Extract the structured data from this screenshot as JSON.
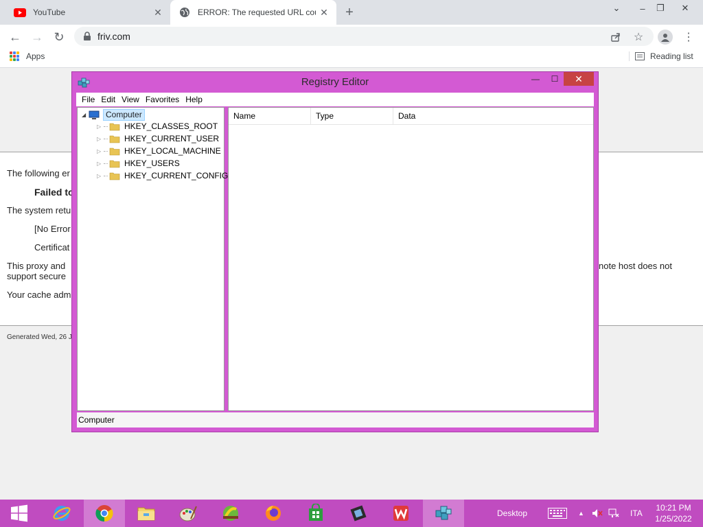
{
  "browser": {
    "tabs": [
      {
        "title": "YouTube",
        "icon": "youtube-icon",
        "active": false
      },
      {
        "title": "ERROR: The requested URL could",
        "icon": "globe-icon",
        "active": true
      }
    ],
    "omnibox": {
      "url": "friv.com"
    },
    "bookmarks": {
      "apps_label": "Apps",
      "reading_list_label": "Reading list"
    }
  },
  "page": {
    "line1": "The following er",
    "line2": "Failed to",
    "line3": "The system retu",
    "line4": "[No Error",
    "line5": "Certificat",
    "line6a": "This proxy and",
    "line6b": "note host does not",
    "line7": "support secure",
    "line8": "Your cache adm",
    "generated": "Generated Wed, 26 J"
  },
  "regedit": {
    "title": "Registry Editor",
    "menu": [
      "File",
      "Edit",
      "View",
      "Favorites",
      "Help"
    ],
    "tree_root": "Computer",
    "hives": [
      "HKEY_CLASSES_ROOT",
      "HKEY_CURRENT_USER",
      "HKEY_LOCAL_MACHINE",
      "HKEY_USERS",
      "HKEY_CURRENT_CONFIG"
    ],
    "columns": [
      "Name",
      "Type",
      "Data"
    ],
    "status": "Computer"
  },
  "taskbar": {
    "apps": [
      "start-button",
      "internet-explorer-icon",
      "chrome-icon",
      "file-explorer-icon",
      "paint-icon",
      "app-icon",
      "firefox-icon",
      "store-icon",
      "movie-maker-icon",
      "wps-office-icon",
      "registry-editor-icon"
    ],
    "active_app": "registry-editor-icon",
    "desktop_label": "Desktop",
    "language": "ITA",
    "time": "10:21 PM",
    "date": "1/25/2022"
  },
  "colors": {
    "accent": "#c04cc0",
    "window_frame": "#d35ad3",
    "close_button": "#c74343",
    "selection": "#cce8ff"
  }
}
